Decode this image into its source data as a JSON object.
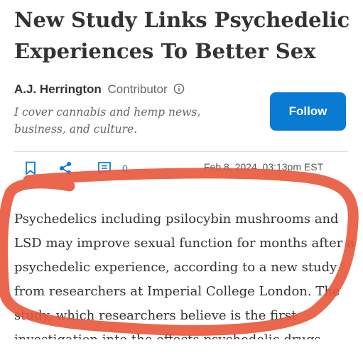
{
  "article": {
    "headline": "New Study Links Psychedelic Experiences To Better Sex",
    "author": {
      "name": "A.J. Herrington",
      "role": "Contributor",
      "bio": "I cover cannabis and hemp news, business, and culture."
    },
    "follow_label": "Follow",
    "actions": {
      "bookmark_icon": "bookmark-icon",
      "share_icon": "share-icon",
      "comment_icon": "comment-icon",
      "comment_count": "0"
    },
    "date": "Feb 8, 2024, 03:13pm EST",
    "body": "Psychedelics including psilocybin mushrooms and LSD may improve sexual function for months after a psychedelic experience, according to a new study from researchers at Imperial College London. The study, which researchers believe is the first investigation into the effects psychedelic drugs"
  },
  "colors": {
    "accent": "#0a7bd3",
    "annotation": "#e8553a"
  }
}
